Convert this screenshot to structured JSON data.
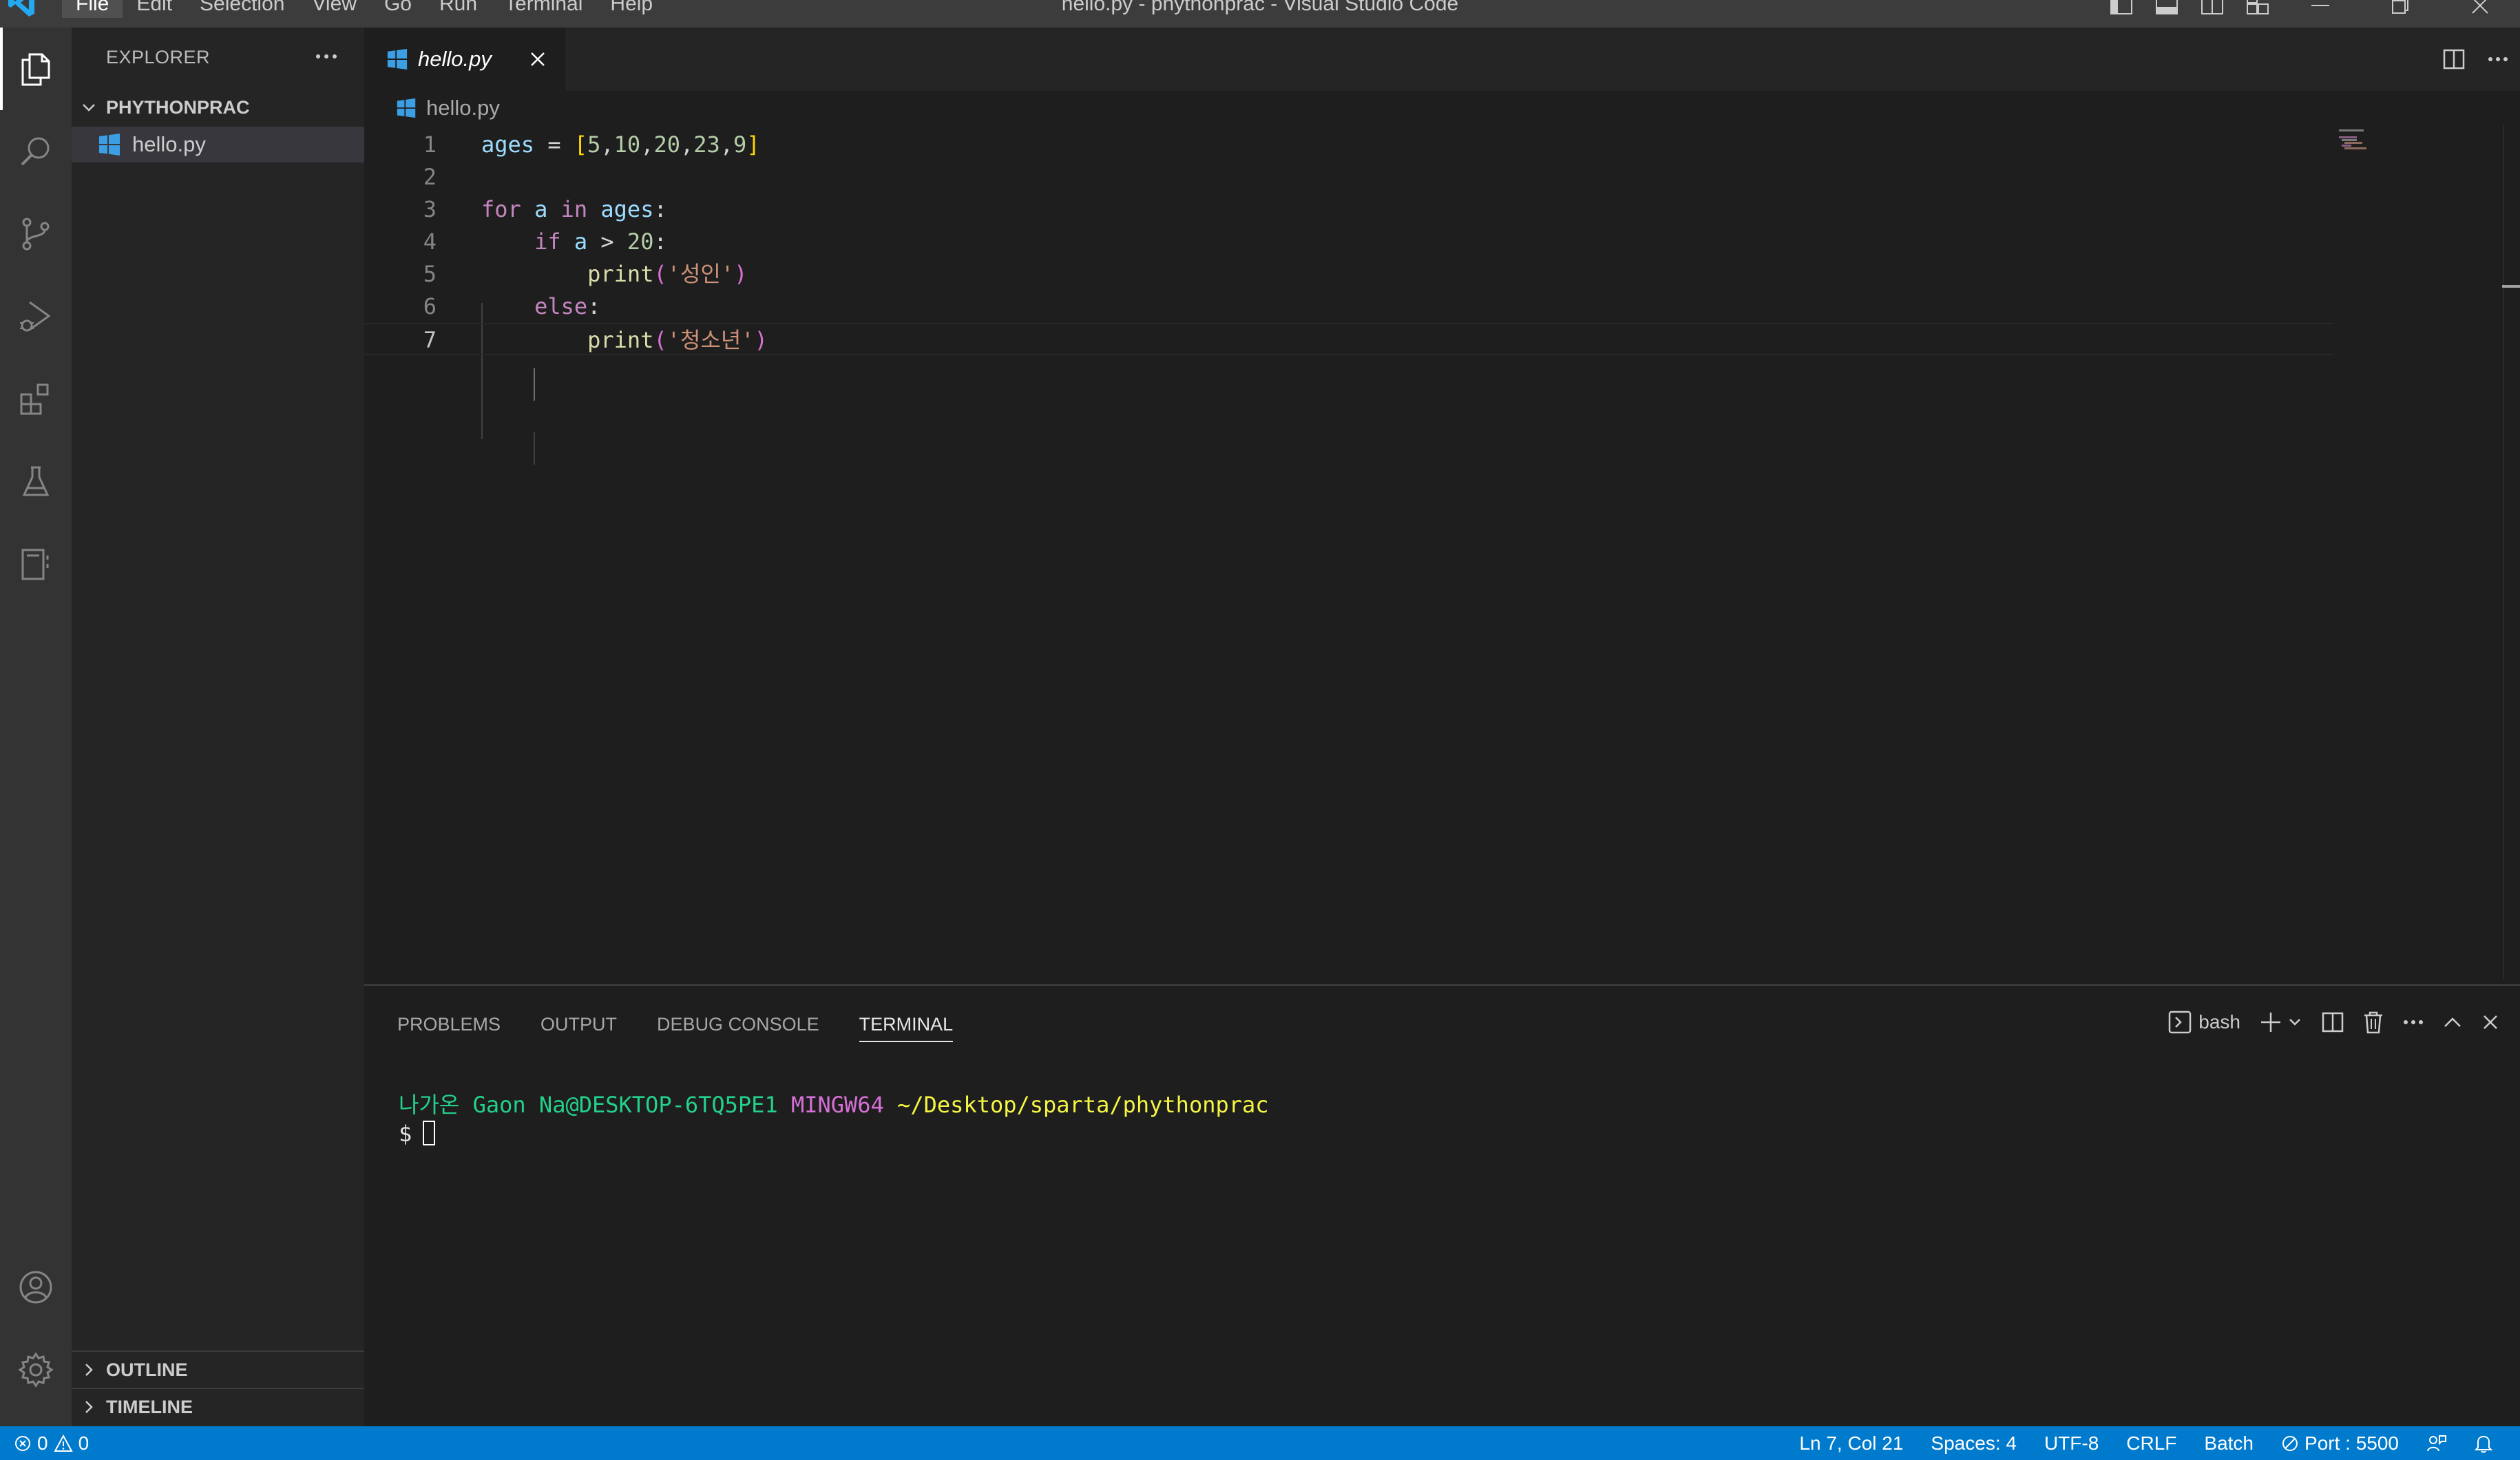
{
  "window": {
    "title": "hello.py - phythonprac - Visual Studio Code",
    "menu": [
      "File",
      "Edit",
      "Selection",
      "View",
      "Go",
      "Run",
      "Terminal",
      "Help"
    ]
  },
  "sidebar": {
    "header": "EXPLORER",
    "folder": "PHYTHONPRAC",
    "files": [
      "hello.py"
    ],
    "outline": "OUTLINE",
    "timeline": "TIMELINE"
  },
  "editor": {
    "tab_label": "hello.py",
    "breadcrumb": "hello.py",
    "line_numbers": [
      "1",
      "2",
      "3",
      "4",
      "5",
      "6",
      "7"
    ],
    "current_line": 7,
    "lines": [
      [
        {
          "t": "ages",
          "c": "var"
        },
        {
          "t": " = ",
          "c": "plain"
        },
        {
          "t": "[",
          "c": "br1"
        },
        {
          "t": "5",
          "c": "num"
        },
        {
          "t": ",",
          "c": "plain"
        },
        {
          "t": "10",
          "c": "num"
        },
        {
          "t": ",",
          "c": "plain"
        },
        {
          "t": "20",
          "c": "num"
        },
        {
          "t": ",",
          "c": "plain"
        },
        {
          "t": "23",
          "c": "num"
        },
        {
          "t": ",",
          "c": "plain"
        },
        {
          "t": "9",
          "c": "num"
        },
        {
          "t": "]",
          "c": "br1"
        }
      ],
      [],
      [
        {
          "t": "for",
          "c": "kw"
        },
        {
          "t": " ",
          "c": "plain"
        },
        {
          "t": "a",
          "c": "var"
        },
        {
          "t": " ",
          "c": "plain"
        },
        {
          "t": "in",
          "c": "kw"
        },
        {
          "t": " ",
          "c": "plain"
        },
        {
          "t": "ages",
          "c": "var"
        },
        {
          "t": ":",
          "c": "plain"
        }
      ],
      [
        {
          "t": "    ",
          "c": "plain"
        },
        {
          "t": "if",
          "c": "kw"
        },
        {
          "t": " ",
          "c": "plain"
        },
        {
          "t": "a",
          "c": "var"
        },
        {
          "t": " > ",
          "c": "plain"
        },
        {
          "t": "20",
          "c": "num"
        },
        {
          "t": ":",
          "c": "plain"
        }
      ],
      [
        {
          "t": "        ",
          "c": "plain"
        },
        {
          "t": "print",
          "c": "fn"
        },
        {
          "t": "(",
          "c": "br2"
        },
        {
          "t": "'성인'",
          "c": "str"
        },
        {
          "t": ")",
          "c": "br2"
        }
      ],
      [
        {
          "t": "    ",
          "c": "plain"
        },
        {
          "t": "else",
          "c": "kw"
        },
        {
          "t": ":",
          "c": "plain"
        }
      ],
      [
        {
          "t": "        ",
          "c": "plain"
        },
        {
          "t": "print",
          "c": "fn"
        },
        {
          "t": "(",
          "c": "br2"
        },
        {
          "t": "'청소년'",
          "c": "str"
        },
        {
          "t": ")",
          "c": "br2"
        }
      ]
    ]
  },
  "panel": {
    "tabs": [
      "PROBLEMS",
      "OUTPUT",
      "DEBUG CONSOLE",
      "TERMINAL"
    ],
    "active_tab": "TERMINAL",
    "terminal_profile": "bash",
    "terminal": {
      "user": "나가온",
      "host": "Gaon Na@DESKTOP-6TQ5PE1",
      "system": "MINGW64",
      "path": "~/Desktop/sparta/phythonprac",
      "prompt": "$"
    }
  },
  "statusbar": {
    "errors": "0",
    "warnings": "0",
    "position": "Ln 7, Col 21",
    "spaces": "Spaces: 4",
    "encoding": "UTF-8",
    "eol": "CRLF",
    "language": "Batch",
    "port": "Port : 5500"
  },
  "colors": {
    "accent": "#007acc",
    "keyword": "#c586c0",
    "variable": "#9cdcfe",
    "number": "#b5cea8",
    "string": "#ce9178",
    "function": "#dcdcaa",
    "bracket_level1": "#ffd700",
    "bracket_level2": "#da70d6",
    "terminal_green": "#23d18b",
    "terminal_magenta": "#d670d6",
    "terminal_yellow": "#f5f543"
  }
}
